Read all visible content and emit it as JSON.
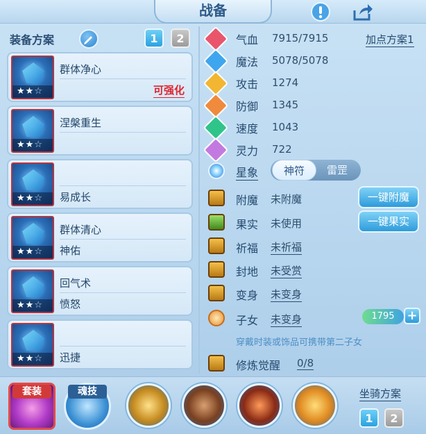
{
  "window": {
    "title": "战备"
  },
  "equip_plan": {
    "label": "装备方案",
    "tabs": [
      "1",
      "2"
    ]
  },
  "equipment": [
    {
      "line1": "群体净心",
      "line2": "",
      "upgrade": "可强化",
      "stars_filled": 2,
      "stars_total": 3
    },
    {
      "line1": "涅槃重生",
      "line2": "",
      "upgrade": "",
      "stars_filled": 2,
      "stars_total": 3
    },
    {
      "line1": "",
      "line2": "易成长",
      "upgrade": "",
      "stars_filled": 2,
      "stars_total": 3
    },
    {
      "line1": "群体清心",
      "line2": "神佑",
      "upgrade": "",
      "stars_filled": 2,
      "stars_total": 3
    },
    {
      "line1": "回气术",
      "line2": "愤怒",
      "upgrade": "",
      "stars_filled": 2,
      "stars_total": 3
    },
    {
      "line1": "",
      "line2": "迅捷",
      "upgrade": "",
      "stars_filled": 2,
      "stars_total": 3
    }
  ],
  "stats": [
    {
      "name": "气血",
      "value": "7915/7915",
      "icon": "heart-icon",
      "color": "#e9566c"
    },
    {
      "name": "魔法",
      "value": "5078/5078",
      "icon": "mana-icon",
      "color": "#3ea6ef"
    },
    {
      "name": "攻击",
      "value": "1274",
      "icon": "attack-icon",
      "color": "#f2b632"
    },
    {
      "name": "防御",
      "value": "1345",
      "icon": "defense-icon",
      "color": "#f08a3c"
    },
    {
      "name": "速度",
      "value": "1043",
      "icon": "speed-icon",
      "color": "#2fc48a"
    },
    {
      "name": "灵力",
      "value": "722",
      "icon": "spirit-icon",
      "color": "#c37ae0"
    }
  ],
  "add_plan": "加点方案1",
  "star_sign": {
    "label": "星象",
    "options": [
      "神符",
      "雷罡"
    ],
    "selected": "神符"
  },
  "features": [
    {
      "name": "附魔",
      "value": "未附魔",
      "button": "一键附魔"
    },
    {
      "name": "果实",
      "value": "未使用",
      "button": "一键果实"
    },
    {
      "name": "祈福",
      "value": "未祈福",
      "button": ""
    },
    {
      "name": "封地",
      "value": "未受赏",
      "button": ""
    },
    {
      "name": "变身",
      "value": "未变身",
      "button": ""
    },
    {
      "name": "子女",
      "value": "未变身",
      "button": ""
    },
    {
      "name": "修炼觉醒",
      "value": "0/8",
      "button": ""
    }
  ],
  "children_counter": "1795",
  "children_hint": "穿戴时装或饰品可携带第二子女",
  "bottom": {
    "suit_label": "套装",
    "soul_label": "魂技",
    "mount_label": "坐骑方案",
    "mount_tabs": [
      "1",
      "2"
    ]
  },
  "colors": {
    "accent": "#2aa2e0",
    "upgrade": "#e0242f",
    "frame_red": "#b8333f"
  }
}
